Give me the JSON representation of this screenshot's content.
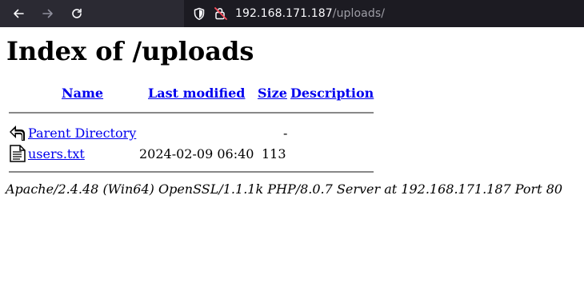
{
  "browser": {
    "url_host": "192.168.171.187",
    "url_path": "/uploads/"
  },
  "page": {
    "title": "Index of /uploads",
    "columns": {
      "name": "Name",
      "last_modified": "Last modified",
      "size": "Size",
      "description": "Description"
    },
    "rows": [
      {
        "icon": "back-arrow-icon",
        "name": "Parent Directory",
        "modified": "",
        "size": "-",
        "description": ""
      },
      {
        "icon": "text-file-icon",
        "name": "users.txt",
        "modified": "2024-02-09 06:40",
        "size": "113",
        "description": ""
      }
    ],
    "footer": "Apache/2.4.48 (Win64) OpenSSL/1.1.1k PHP/8.0.7 Server at 192.168.171.187 Port 80"
  }
}
